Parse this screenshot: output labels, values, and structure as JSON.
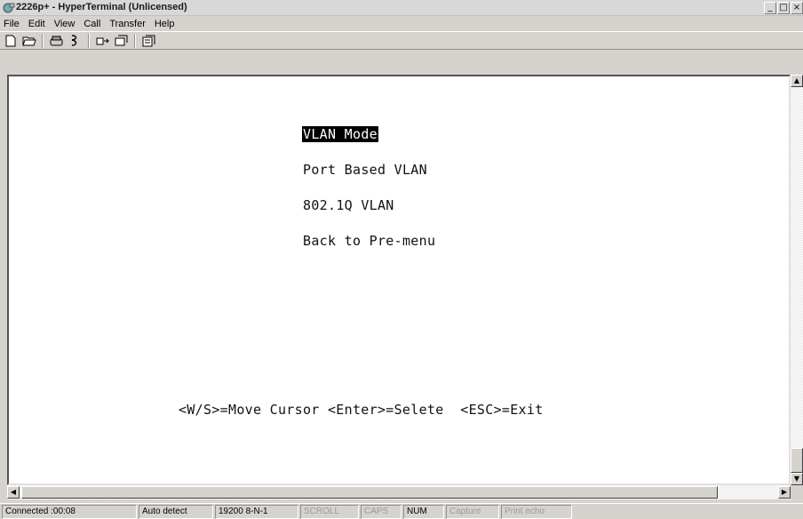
{
  "window": {
    "title": "2226p+ - HyperTerminal (Unlicensed)",
    "controls": [
      "_",
      "□",
      "×"
    ]
  },
  "menubar": [
    "File",
    "Edit",
    "View",
    "Call",
    "Transfer",
    "Help"
  ],
  "toolbar": [
    "new-icon",
    "open-icon",
    "disconnect-icon",
    "dial-icon",
    "send-icon",
    "receive-icon",
    "properties-icon"
  ],
  "terminal": {
    "menu_title": "VLAN Mode",
    "options": [
      "Port Based VLAN",
      "802.1Q VLAN",
      "Back to Pre-menu"
    ],
    "hint": "<W/S>=Move Cursor <Enter>=Selete  <ESC>=Exit"
  },
  "statusbar": {
    "connected": "Connected :00:08",
    "detect": "Auto detect",
    "settings": "19200 8-N-1",
    "scroll": "SCROLL",
    "caps": "CAPS",
    "num": "NUM",
    "capture": "Capture",
    "print_echo": "Print echo"
  }
}
